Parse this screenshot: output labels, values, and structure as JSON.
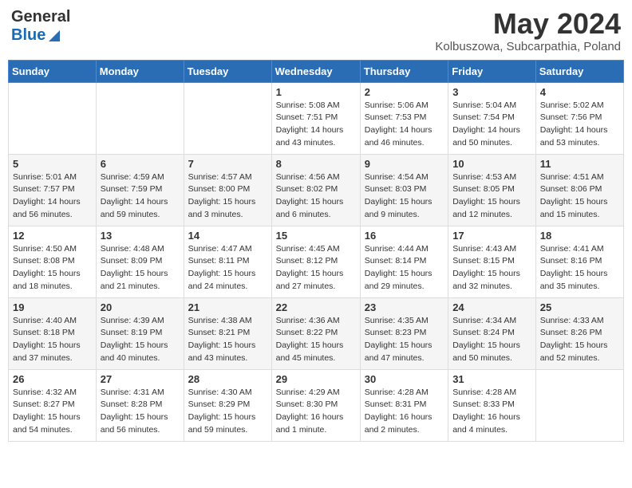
{
  "header": {
    "logo_general": "General",
    "logo_blue": "Blue",
    "month_title": "May 2024",
    "location": "Kolbuszowa, Subcarpathia, Poland"
  },
  "weekdays": [
    "Sunday",
    "Monday",
    "Tuesday",
    "Wednesday",
    "Thursday",
    "Friday",
    "Saturday"
  ],
  "weeks": [
    [
      {
        "day": "",
        "sunrise": "",
        "sunset": "",
        "daylight": ""
      },
      {
        "day": "",
        "sunrise": "",
        "sunset": "",
        "daylight": ""
      },
      {
        "day": "",
        "sunrise": "",
        "sunset": "",
        "daylight": ""
      },
      {
        "day": "1",
        "sunrise": "Sunrise: 5:08 AM",
        "sunset": "Sunset: 7:51 PM",
        "daylight": "Daylight: 14 hours and 43 minutes."
      },
      {
        "day": "2",
        "sunrise": "Sunrise: 5:06 AM",
        "sunset": "Sunset: 7:53 PM",
        "daylight": "Daylight: 14 hours and 46 minutes."
      },
      {
        "day": "3",
        "sunrise": "Sunrise: 5:04 AM",
        "sunset": "Sunset: 7:54 PM",
        "daylight": "Daylight: 14 hours and 50 minutes."
      },
      {
        "day": "4",
        "sunrise": "Sunrise: 5:02 AM",
        "sunset": "Sunset: 7:56 PM",
        "daylight": "Daylight: 14 hours and 53 minutes."
      }
    ],
    [
      {
        "day": "5",
        "sunrise": "Sunrise: 5:01 AM",
        "sunset": "Sunset: 7:57 PM",
        "daylight": "Daylight: 14 hours and 56 minutes."
      },
      {
        "day": "6",
        "sunrise": "Sunrise: 4:59 AM",
        "sunset": "Sunset: 7:59 PM",
        "daylight": "Daylight: 14 hours and 59 minutes."
      },
      {
        "day": "7",
        "sunrise": "Sunrise: 4:57 AM",
        "sunset": "Sunset: 8:00 PM",
        "daylight": "Daylight: 15 hours and 3 minutes."
      },
      {
        "day": "8",
        "sunrise": "Sunrise: 4:56 AM",
        "sunset": "Sunset: 8:02 PM",
        "daylight": "Daylight: 15 hours and 6 minutes."
      },
      {
        "day": "9",
        "sunrise": "Sunrise: 4:54 AM",
        "sunset": "Sunset: 8:03 PM",
        "daylight": "Daylight: 15 hours and 9 minutes."
      },
      {
        "day": "10",
        "sunrise": "Sunrise: 4:53 AM",
        "sunset": "Sunset: 8:05 PM",
        "daylight": "Daylight: 15 hours and 12 minutes."
      },
      {
        "day": "11",
        "sunrise": "Sunrise: 4:51 AM",
        "sunset": "Sunset: 8:06 PM",
        "daylight": "Daylight: 15 hours and 15 minutes."
      }
    ],
    [
      {
        "day": "12",
        "sunrise": "Sunrise: 4:50 AM",
        "sunset": "Sunset: 8:08 PM",
        "daylight": "Daylight: 15 hours and 18 minutes."
      },
      {
        "day": "13",
        "sunrise": "Sunrise: 4:48 AM",
        "sunset": "Sunset: 8:09 PM",
        "daylight": "Daylight: 15 hours and 21 minutes."
      },
      {
        "day": "14",
        "sunrise": "Sunrise: 4:47 AM",
        "sunset": "Sunset: 8:11 PM",
        "daylight": "Daylight: 15 hours and 24 minutes."
      },
      {
        "day": "15",
        "sunrise": "Sunrise: 4:45 AM",
        "sunset": "Sunset: 8:12 PM",
        "daylight": "Daylight: 15 hours and 27 minutes."
      },
      {
        "day": "16",
        "sunrise": "Sunrise: 4:44 AM",
        "sunset": "Sunset: 8:14 PM",
        "daylight": "Daylight: 15 hours and 29 minutes."
      },
      {
        "day": "17",
        "sunrise": "Sunrise: 4:43 AM",
        "sunset": "Sunset: 8:15 PM",
        "daylight": "Daylight: 15 hours and 32 minutes."
      },
      {
        "day": "18",
        "sunrise": "Sunrise: 4:41 AM",
        "sunset": "Sunset: 8:16 PM",
        "daylight": "Daylight: 15 hours and 35 minutes."
      }
    ],
    [
      {
        "day": "19",
        "sunrise": "Sunrise: 4:40 AM",
        "sunset": "Sunset: 8:18 PM",
        "daylight": "Daylight: 15 hours and 37 minutes."
      },
      {
        "day": "20",
        "sunrise": "Sunrise: 4:39 AM",
        "sunset": "Sunset: 8:19 PM",
        "daylight": "Daylight: 15 hours and 40 minutes."
      },
      {
        "day": "21",
        "sunrise": "Sunrise: 4:38 AM",
        "sunset": "Sunset: 8:21 PM",
        "daylight": "Daylight: 15 hours and 43 minutes."
      },
      {
        "day": "22",
        "sunrise": "Sunrise: 4:36 AM",
        "sunset": "Sunset: 8:22 PM",
        "daylight": "Daylight: 15 hours and 45 minutes."
      },
      {
        "day": "23",
        "sunrise": "Sunrise: 4:35 AM",
        "sunset": "Sunset: 8:23 PM",
        "daylight": "Daylight: 15 hours and 47 minutes."
      },
      {
        "day": "24",
        "sunrise": "Sunrise: 4:34 AM",
        "sunset": "Sunset: 8:24 PM",
        "daylight": "Daylight: 15 hours and 50 minutes."
      },
      {
        "day": "25",
        "sunrise": "Sunrise: 4:33 AM",
        "sunset": "Sunset: 8:26 PM",
        "daylight": "Daylight: 15 hours and 52 minutes."
      }
    ],
    [
      {
        "day": "26",
        "sunrise": "Sunrise: 4:32 AM",
        "sunset": "Sunset: 8:27 PM",
        "daylight": "Daylight: 15 hours and 54 minutes."
      },
      {
        "day": "27",
        "sunrise": "Sunrise: 4:31 AM",
        "sunset": "Sunset: 8:28 PM",
        "daylight": "Daylight: 15 hours and 56 minutes."
      },
      {
        "day": "28",
        "sunrise": "Sunrise: 4:30 AM",
        "sunset": "Sunset: 8:29 PM",
        "daylight": "Daylight: 15 hours and 59 minutes."
      },
      {
        "day": "29",
        "sunrise": "Sunrise: 4:29 AM",
        "sunset": "Sunset: 8:30 PM",
        "daylight": "Daylight: 16 hours and 1 minute."
      },
      {
        "day": "30",
        "sunrise": "Sunrise: 4:28 AM",
        "sunset": "Sunset: 8:31 PM",
        "daylight": "Daylight: 16 hours and 2 minutes."
      },
      {
        "day": "31",
        "sunrise": "Sunrise: 4:28 AM",
        "sunset": "Sunset: 8:33 PM",
        "daylight": "Daylight: 16 hours and 4 minutes."
      },
      {
        "day": "",
        "sunrise": "",
        "sunset": "",
        "daylight": ""
      }
    ]
  ]
}
